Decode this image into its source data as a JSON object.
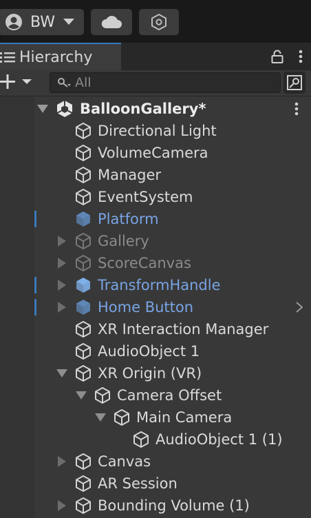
{
  "toolbar": {
    "account": {
      "initials": "BW",
      "icon": "user-circle-icon",
      "dropdown_icon": "caret-down-icon"
    },
    "cloud_icon": "cloud-icon",
    "settings_icon": "hexagon-settings-icon"
  },
  "tab": {
    "icon": "hierarchy-list-icon",
    "title": "Hierarchy",
    "lock_icon": "lock-icon",
    "menu_icon": "kebab-menu-icon"
  },
  "search": {
    "add_icon": "plus-icon",
    "placeholder": "All",
    "toggle_icon": "search-by-type-icon"
  },
  "tree": {
    "scene": {
      "label": "BalloonGallery*",
      "expanded": true
    },
    "items": [
      {
        "label": "Directional Light",
        "depth": 1,
        "arrow": "none",
        "state": "normal",
        "indicator": false
      },
      {
        "label": "VolumeCamera",
        "depth": 1,
        "arrow": "none",
        "state": "normal",
        "indicator": false
      },
      {
        "label": "Manager",
        "depth": 1,
        "arrow": "none",
        "state": "normal",
        "indicator": false
      },
      {
        "label": "EventSystem",
        "depth": 1,
        "arrow": "none",
        "state": "normal",
        "indicator": false
      },
      {
        "label": "Platform",
        "depth": 1,
        "arrow": "none",
        "state": "prefab-inactive",
        "indicator": true
      },
      {
        "label": "Gallery",
        "depth": 1,
        "arrow": "collapsed",
        "state": "inactive",
        "indicator": false
      },
      {
        "label": "ScoreCanvas",
        "depth": 1,
        "arrow": "collapsed",
        "state": "inactive",
        "indicator": false
      },
      {
        "label": "TransformHandle",
        "depth": 1,
        "arrow": "collapsed",
        "state": "prefab",
        "indicator": true
      },
      {
        "label": "Home Button",
        "depth": 1,
        "arrow": "collapsed",
        "state": "prefab-inactive",
        "indicator": true,
        "chevron": true
      },
      {
        "label": "XR Interaction Manager",
        "depth": 1,
        "arrow": "none",
        "state": "normal",
        "indicator": false
      },
      {
        "label": "AudioObject 1",
        "depth": 1,
        "arrow": "none",
        "state": "normal",
        "indicator": false
      },
      {
        "label": "XR Origin (VR)",
        "depth": 1,
        "arrow": "expanded",
        "state": "normal",
        "indicator": false
      },
      {
        "label": "Camera Offset",
        "depth": 2,
        "arrow": "expanded",
        "state": "normal",
        "indicator": false
      },
      {
        "label": "Main Camera",
        "depth": 3,
        "arrow": "expanded",
        "state": "normal",
        "indicator": false
      },
      {
        "label": "AudioObject 1 (1)",
        "depth": 4,
        "arrow": "none",
        "state": "normal",
        "indicator": false
      },
      {
        "label": "Canvas",
        "depth": 1,
        "arrow": "collapsed",
        "state": "normal",
        "indicator": false
      },
      {
        "label": "AR Session",
        "depth": 1,
        "arrow": "none",
        "state": "normal",
        "indicator": false
      },
      {
        "label": "Bounding Volume (1)",
        "depth": 1,
        "arrow": "collapsed",
        "state": "normal",
        "indicator": false
      }
    ]
  },
  "colors": {
    "accent": "#3a79bb",
    "prefab_text": "#78a4e4",
    "inactive_text": "#8b8b8b",
    "background": "#383838"
  }
}
